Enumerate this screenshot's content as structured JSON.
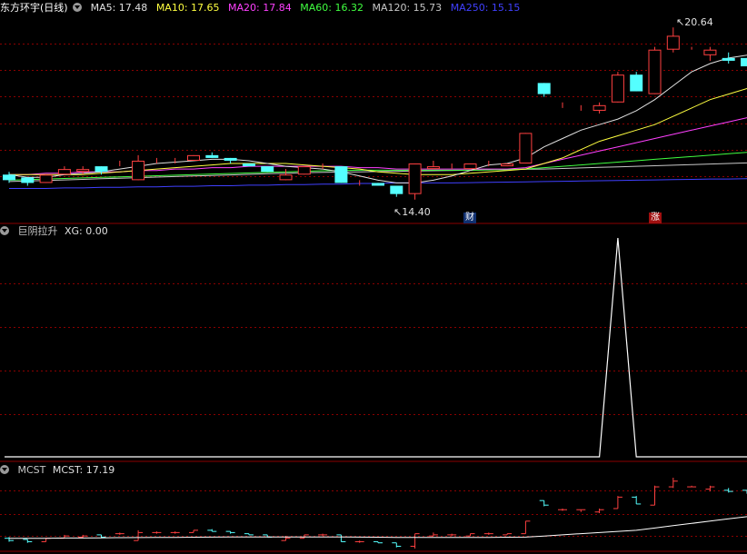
{
  "main_panel": {
    "title": "东方环宇(日线)",
    "indicators": [
      {
        "label": "MA5: 17.48",
        "color": "#e0e0e0"
      },
      {
        "label": "MA10: 17.65",
        "color": "#ffff40"
      },
      {
        "label": "MA20: 17.84",
        "color": "#ff40ff"
      },
      {
        "label": "MA60: 16.32",
        "color": "#40ff40"
      },
      {
        "label": "MA120: 15.73",
        "color": "#c8c8c8"
      },
      {
        "label": "MA250: 15.15",
        "color": "#4040ff"
      }
    ],
    "high_label": "20.64",
    "low_label": "14.40",
    "tag_cai": "财",
    "tag_zhang": "涨"
  },
  "sub_panel_1": {
    "title": "巨阴拉升",
    "value_label": "XG: 0.00",
    "xg_signal": [
      0,
      0,
      0,
      0,
      0,
      0,
      0,
      0,
      0,
      0,
      0,
      0,
      0,
      0,
      0,
      0,
      0,
      0,
      0,
      0,
      0,
      0,
      0,
      0,
      0,
      0,
      0,
      0,
      0,
      0,
      0,
      0,
      0,
      1,
      0,
      0,
      0,
      0,
      0,
      0,
      0
    ]
  },
  "sub_panel_2": {
    "title": "MCST",
    "value_label": "MCST: 17.19"
  },
  "colors": {
    "up": "#ff4040",
    "down": "#54ffff",
    "grid": "#8b0000",
    "ma5": "#e0e0e0",
    "ma10": "#ffff40",
    "ma20": "#ff40ff",
    "ma60": "#40ff40",
    "ma120": "#c8c8c8",
    "ma250": "#4040ff"
  },
  "chart_data": {
    "type": "candlestick",
    "ohlc": [
      [
        15.3,
        15.4,
        15.0,
        15.1
      ],
      [
        15.2,
        15.2,
        14.9,
        15.0
      ],
      [
        15.0,
        15.3,
        15.0,
        15.3
      ],
      [
        15.3,
        15.6,
        15.3,
        15.5
      ],
      [
        15.4,
        15.6,
        15.3,
        15.5
      ],
      [
        15.6,
        15.6,
        15.3,
        15.4
      ],
      [
        15.7,
        15.8,
        15.6,
        15.7
      ],
      [
        15.1,
        16.0,
        15.1,
        15.8
      ],
      [
        15.8,
        15.9,
        15.7,
        15.8
      ],
      [
        15.8,
        15.9,
        15.7,
        15.8
      ],
      [
        15.8,
        16.0,
        15.8,
        16.0
      ],
      [
        16.0,
        16.1,
        15.9,
        15.9
      ],
      [
        15.9,
        15.9,
        15.7,
        15.8
      ],
      [
        15.7,
        15.7,
        15.6,
        15.6
      ],
      [
        15.6,
        15.6,
        15.4,
        15.4
      ],
      [
        15.1,
        15.5,
        15.1,
        15.3
      ],
      [
        15.3,
        15.6,
        15.3,
        15.6
      ],
      [
        15.6,
        15.7,
        15.5,
        15.6
      ],
      [
        15.6,
        15.6,
        15.0,
        15.0
      ],
      [
        15.0,
        15.1,
        14.9,
        15.0
      ],
      [
        15.0,
        15.0,
        14.9,
        14.9
      ],
      [
        14.9,
        14.9,
        14.5,
        14.6
      ],
      [
        14.6,
        15.7,
        14.4,
        15.7
      ],
      [
        15.5,
        15.8,
        15.5,
        15.6
      ],
      [
        15.6,
        15.7,
        15.5,
        15.6
      ],
      [
        15.5,
        15.7,
        15.5,
        15.7
      ],
      [
        15.7,
        15.8,
        15.6,
        15.7
      ],
      [
        15.6,
        15.7,
        15.6,
        15.7
      ],
      [
        15.7,
        16.8,
        15.7,
        16.8
      ],
      [
        18.6,
        18.6,
        18.1,
        18.2
      ],
      [
        17.8,
        17.9,
        17.7,
        17.8
      ],
      [
        17.8,
        17.8,
        17.6,
        17.8
      ],
      [
        17.6,
        17.9,
        17.5,
        17.8
      ],
      [
        17.9,
        19.0,
        17.9,
        18.9
      ],
      [
        18.9,
        19.0,
        18.3,
        18.3
      ],
      [
        18.2,
        19.9,
        18.2,
        19.8
      ],
      [
        19.8,
        20.6,
        19.7,
        20.3
      ],
      [
        19.8,
        19.9,
        19.8,
        19.8
      ],
      [
        19.6,
        19.9,
        19.4,
        19.8
      ],
      [
        19.5,
        19.7,
        19.3,
        19.4
      ],
      [
        19.5,
        19.5,
        19.2,
        19.2
      ]
    ],
    "ma5": [
      15.3,
      15.2,
      15.2,
      15.3,
      15.35,
      15.4,
      15.5,
      15.6,
      15.7,
      15.75,
      15.8,
      15.85,
      15.85,
      15.8,
      15.7,
      15.6,
      15.55,
      15.5,
      15.4,
      15.25,
      15.1,
      15.0,
      15.0,
      15.1,
      15.25,
      15.45,
      15.65,
      15.7,
      15.9,
      16.3,
      16.6,
      16.9,
      17.1,
      17.3,
      17.6,
      18.0,
      18.5,
      19.0,
      19.3,
      19.5,
      19.6
    ],
    "ma10": [
      15.3,
      15.3,
      15.3,
      15.3,
      15.3,
      15.35,
      15.4,
      15.45,
      15.5,
      15.55,
      15.6,
      15.65,
      15.7,
      15.7,
      15.7,
      15.7,
      15.65,
      15.6,
      15.55,
      15.5,
      15.4,
      15.35,
      15.3,
      15.3,
      15.3,
      15.35,
      15.4,
      15.45,
      15.5,
      15.7,
      15.9,
      16.2,
      16.5,
      16.7,
      16.9,
      17.1,
      17.4,
      17.7,
      18.0,
      18.2,
      18.4
    ],
    "ma20": [
      15.3,
      15.3,
      15.35,
      15.35,
      15.4,
      15.4,
      15.4,
      15.45,
      15.45,
      15.5,
      15.5,
      15.55,
      15.55,
      15.6,
      15.6,
      15.6,
      15.6,
      15.6,
      15.6,
      15.55,
      15.55,
      15.5,
      15.5,
      15.5,
      15.5,
      15.5,
      15.5,
      15.5,
      15.55,
      15.7,
      15.85,
      16.0,
      16.15,
      16.3,
      16.45,
      16.6,
      16.75,
      16.9,
      17.05,
      17.2,
      17.35
    ],
    "ma60": [
      15.1,
      15.12,
      15.14,
      15.16,
      15.18,
      15.2,
      15.22,
      15.24,
      15.26,
      15.28,
      15.3,
      15.32,
      15.34,
      15.36,
      15.38,
      15.4,
      15.42,
      15.44,
      15.45,
      15.46,
      15.46,
      15.46,
      15.46,
      15.46,
      15.46,
      15.46,
      15.47,
      15.48,
      15.5,
      15.55,
      15.6,
      15.65,
      15.7,
      15.75,
      15.8,
      15.85,
      15.9,
      15.95,
      16.0,
      16.05,
      16.1
    ],
    "ma120": [
      15.05,
      15.07,
      15.09,
      15.11,
      15.13,
      15.15,
      15.17,
      15.19,
      15.21,
      15.23,
      15.25,
      15.27,
      15.29,
      15.31,
      15.33,
      15.35,
      15.37,
      15.38,
      15.39,
      15.4,
      15.41,
      15.42,
      15.43,
      15.44,
      15.45,
      15.46,
      15.47,
      15.48,
      15.49,
      15.5,
      15.52,
      15.54,
      15.56,
      15.58,
      15.6,
      15.62,
      15.64,
      15.66,
      15.68,
      15.7,
      15.72
    ],
    "ma250": [
      14.8,
      14.8,
      14.8,
      14.82,
      14.82,
      14.84,
      14.84,
      14.86,
      14.86,
      14.88,
      14.88,
      14.9,
      14.9,
      14.92,
      14.92,
      14.94,
      14.94,
      14.96,
      14.96,
      14.98,
      14.98,
      15.0,
      15.0,
      15.0,
      15.0,
      15.01,
      15.02,
      15.03,
      15.04,
      15.05,
      15.06,
      15.07,
      15.08,
      15.09,
      15.1,
      15.11,
      15.12,
      15.13,
      15.14,
      15.14,
      15.15
    ],
    "mcst": [
      15.3,
      15.3,
      15.3,
      15.32,
      15.32,
      15.34,
      15.35,
      15.36,
      15.37,
      15.38,
      15.39,
      15.4,
      15.41,
      15.42,
      15.42,
      15.42,
      15.42,
      15.42,
      15.42,
      15.4,
      15.39,
      15.38,
      15.37,
      15.37,
      15.37,
      15.37,
      15.38,
      15.39,
      15.4,
      15.5,
      15.6,
      15.7,
      15.8,
      15.9,
      16.0,
      16.2,
      16.4,
      16.6,
      16.8,
      17.0,
      17.19
    ],
    "ylim_main": [
      14.0,
      21.0
    ],
    "ylim_mcst": [
      14.4,
      20.6
    ]
  }
}
